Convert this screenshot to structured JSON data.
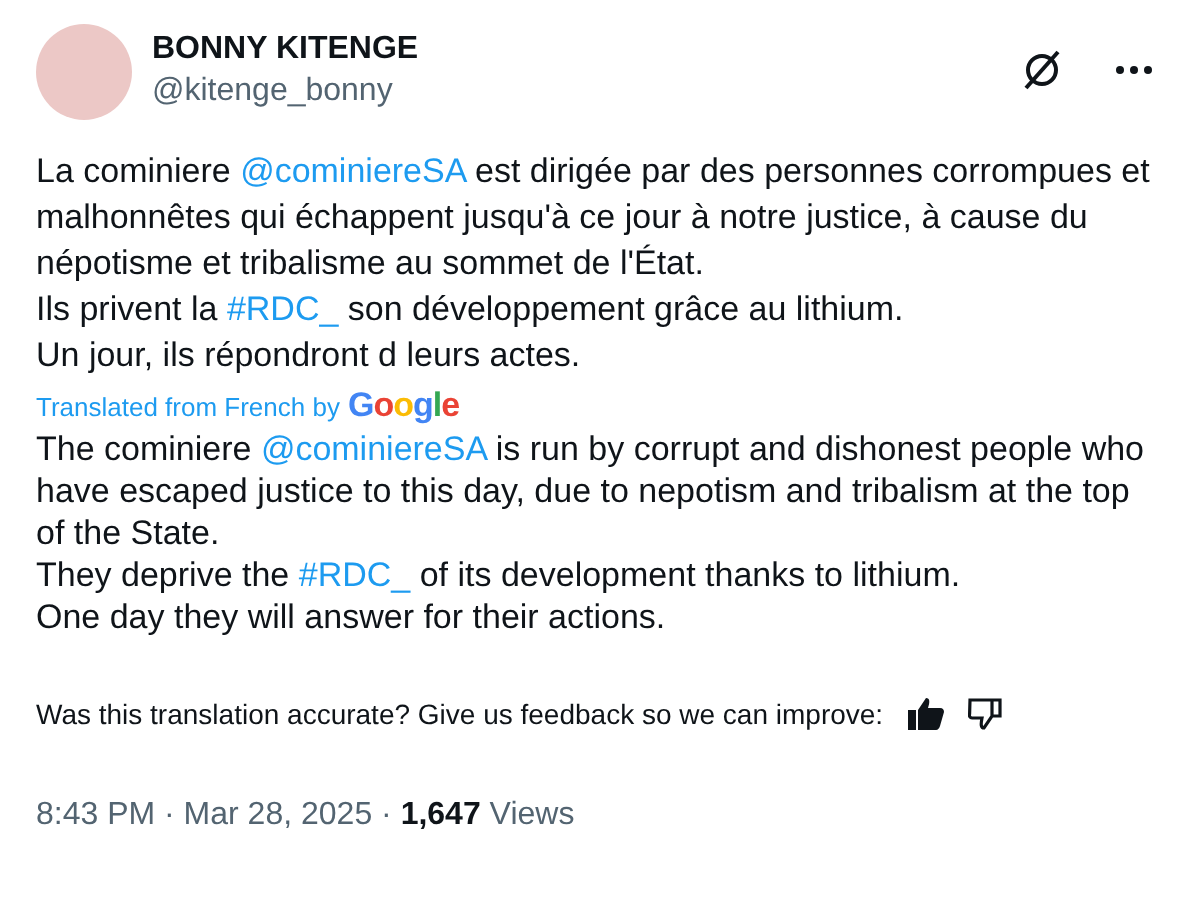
{
  "author": {
    "name": "BONNY KITENGE",
    "handle": "@kitenge_bonny"
  },
  "original_text": [
    [
      {
        "kind": "text",
        "text": "La cominiere "
      },
      {
        "kind": "mention",
        "text": "@cominiereSA"
      },
      {
        "kind": "text",
        "text": " est dirigée par des personnes corrompues et malhonnêtes qui échappent jusqu'à ce jour à notre justice, à cause du népotisme et tribalisme au sommet de l'État."
      }
    ],
    [
      {
        "kind": "text",
        "text": "Ils privent la "
      },
      {
        "kind": "hashtag",
        "text": "#RDC_"
      },
      {
        "kind": "text",
        "text": " son développement grâce au lithium."
      }
    ],
    [
      {
        "kind": "text",
        "text": "Un jour, ils répondront d leurs actes."
      }
    ]
  ],
  "translation_credit": {
    "label": "Translated from French by",
    "provider": "Google"
  },
  "translated_text": [
    [
      {
        "kind": "text",
        "text": "The cominiere "
      },
      {
        "kind": "mention",
        "text": "@cominiereSA"
      },
      {
        "kind": "text",
        "text": " is run by corrupt and dishonest people who have escaped justice to this day, due to nepotism and tribalism at the top of the State."
      }
    ],
    [
      {
        "kind": "text",
        "text": "They deprive the "
      },
      {
        "kind": "hashtag",
        "text": "#RDC_"
      },
      {
        "kind": "text",
        "text": " of its development thanks to lithium."
      }
    ],
    [
      {
        "kind": "text",
        "text": "One day they will answer for their actions."
      }
    ]
  ],
  "feedback": {
    "question": "Was this translation accurate? Give us feedback so we can improve:"
  },
  "meta": {
    "time": "8:43 PM · Mar 28, 2025 · ",
    "views_count": "1,647",
    "views_label": "Views"
  }
}
